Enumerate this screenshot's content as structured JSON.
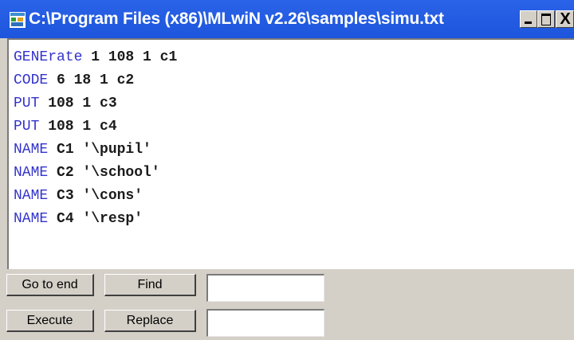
{
  "window": {
    "title": "C:\\Program Files (x86)\\MLwiN v2.26\\samples\\simu.txt",
    "icon": "mlwin-app-icon",
    "controls": {
      "minimize": "minimize-icon",
      "maximize": "maximize-icon",
      "close_glyph": "X"
    }
  },
  "editor": {
    "lines": [
      {
        "keyword": "GENErate",
        "args": " 1 108 1 c1"
      },
      {
        "keyword": "CODE",
        "args": " 6 18 1 c2"
      },
      {
        "keyword": "PUT",
        "args": " 108 1 c3"
      },
      {
        "keyword": "PUT",
        "args": " 108 1 c4"
      },
      {
        "keyword": "NAME",
        "args": " C1 '\\pupil'"
      },
      {
        "keyword": "NAME",
        "args": " C2 '\\school'"
      },
      {
        "keyword": "NAME",
        "args": " C3 '\\cons'"
      },
      {
        "keyword": "NAME",
        "args": " C4 '\\resp'"
      }
    ],
    "colors": {
      "keyword": "#3333cc",
      "text": "#1a1a1a"
    }
  },
  "buttons": {
    "go_to_end": "Go to end",
    "find": "Find",
    "execute": "Execute",
    "replace": "Replace"
  },
  "inputs": {
    "find_value": "",
    "replace_value": ""
  },
  "colors": {
    "titlebar": "#1d55dc",
    "face": "#d4d0c8"
  }
}
